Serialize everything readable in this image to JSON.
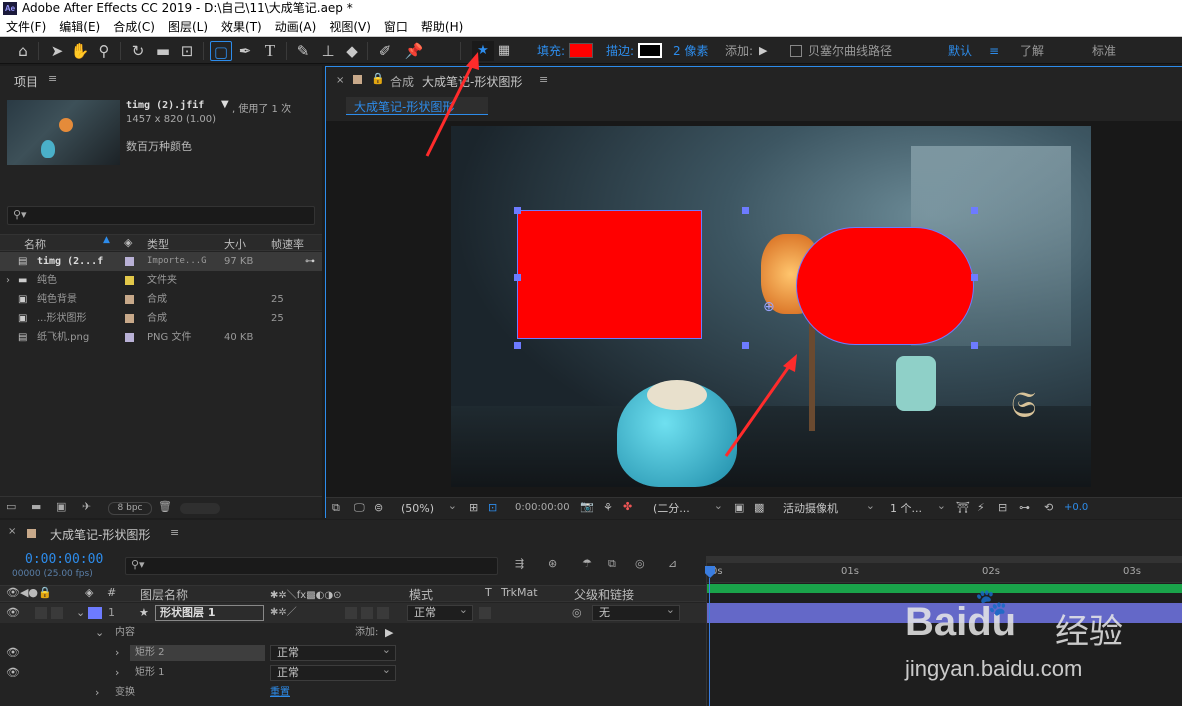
{
  "window": {
    "title": "Adobe After Effects CC 2019 - D:\\自己\\11\\大成笔记.aep *",
    "logo": "Ae"
  },
  "menu": [
    "文件(F)",
    "编辑(E)",
    "合成(C)",
    "图层(L)",
    "效果(T)",
    "动画(A)",
    "视图(V)",
    "窗口",
    "帮助(H)"
  ],
  "toolbar": {
    "fill_label": "填充:",
    "stroke_label": "描边:",
    "stroke_width": "2 像素",
    "add_label": "添加:",
    "bezier_label": "贝塞尔曲线路径",
    "workspace_default": "默认",
    "workspace_learn": "了解",
    "workspace_standard": "标准",
    "fill_color": "#ff0000",
    "accent": "#2d8ceb"
  },
  "project": {
    "title": "项目",
    "preview_name": "timg (2).jfif",
    "preview_usage": ", 使用了 1 次",
    "preview_dims": "1457 x 820 (1.00)",
    "preview_colors": "数百万种颜色",
    "columns": {
      "name": "名称",
      "type": "类型",
      "size": "大小",
      "fps": "帧速率"
    },
    "items": [
      {
        "name": "timg (2...f",
        "type": "Importe...G",
        "size": "97 KB",
        "fps": "",
        "color": "#b9b1d6",
        "icon": "image-file-icon"
      },
      {
        "name": "纯色",
        "type": "文件夹",
        "size": "",
        "fps": "",
        "color": "#e3c84a",
        "icon": "folder-icon"
      },
      {
        "name": "纯色背景",
        "type": "合成",
        "size": "",
        "fps": "25",
        "color": "#c8a98a",
        "icon": "composition-icon"
      },
      {
        "name": "...形状图形",
        "type": "合成",
        "size": "",
        "fps": "25",
        "color": "#c8a98a",
        "icon": "composition-icon"
      },
      {
        "name": "纸飞机.png",
        "type": "PNG 文件",
        "size": "40 KB",
        "fps": "",
        "color": "#b9b1d6",
        "icon": "image-file-icon"
      }
    ],
    "bpc": "8 bpc"
  },
  "composition": {
    "panel_prefix": "合成",
    "name": "大成笔记-形状图形",
    "tab": "大成笔记-形状图形",
    "zoom": "(50%)",
    "timecode": "0:00:00:00",
    "resolution": "(二分...",
    "camera": "活动摄像机",
    "views": "1 个...",
    "exposure": "+0.0"
  },
  "timeline": {
    "comp_name": "大成笔记-形状图形",
    "timecode": "0:00:00:00",
    "frames": "00000 (25.00 fps)",
    "columns": {
      "num": "#",
      "layer_name": "图层名称",
      "mode": "模式",
      "t": "T",
      "trkmat": "TrkMat",
      "parent": "父级和链接"
    },
    "layer": {
      "index": "1",
      "name": "形状图层 1",
      "mode": "正常",
      "parent": "无",
      "label_color": "#6d7bff"
    },
    "contents_label": "内容",
    "add_label": "添加:",
    "sublayers": [
      {
        "name": "矩形 2",
        "mode": "正常"
      },
      {
        "name": "矩形 1",
        "mode": "正常"
      }
    ],
    "transform_label": "变换",
    "reset_label": "重置",
    "ruler": [
      "0s",
      "01s",
      "02s",
      "03s"
    ]
  },
  "watermark": {
    "brand": "Baidu",
    "cn": "经验",
    "url": "jingyan.baidu.com"
  }
}
